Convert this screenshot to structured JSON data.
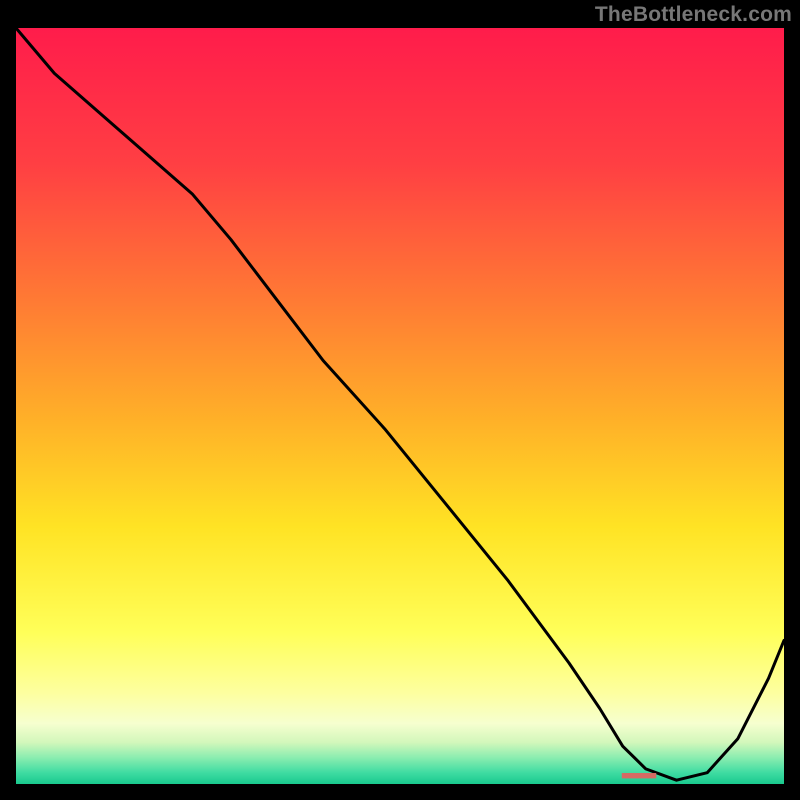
{
  "watermark": "TheBottleneck.com",
  "marker_label": "■■■■■■■■■",
  "chart_data": {
    "type": "line",
    "title": "",
    "xlabel": "",
    "ylabel": "",
    "xlim": [
      0,
      100
    ],
    "ylim": [
      0,
      100
    ],
    "series": [
      {
        "name": "curve",
        "x": [
          0,
          5,
          23,
          28,
          34,
          40,
          48,
          56,
          64,
          72,
          76,
          79,
          82,
          86,
          90,
          94,
          98,
          100
        ],
        "y": [
          100,
          94,
          78,
          72,
          64,
          56,
          47,
          37,
          27,
          16,
          10,
          5,
          2,
          0.5,
          1.5,
          6,
          14,
          19
        ]
      }
    ],
    "marker": {
      "x": 84,
      "y": 0.5
    },
    "gradient_stops": [
      {
        "offset": 0.0,
        "color": "#ff1c4b"
      },
      {
        "offset": 0.18,
        "color": "#ff3f43"
      },
      {
        "offset": 0.36,
        "color": "#ff7a34"
      },
      {
        "offset": 0.52,
        "color": "#ffb128"
      },
      {
        "offset": 0.66,
        "color": "#ffe324"
      },
      {
        "offset": 0.8,
        "color": "#ffff59"
      },
      {
        "offset": 0.88,
        "color": "#fdffa0"
      },
      {
        "offset": 0.92,
        "color": "#f6ffcf"
      },
      {
        "offset": 0.945,
        "color": "#d2f7bb"
      },
      {
        "offset": 0.965,
        "color": "#8bedb0"
      },
      {
        "offset": 0.985,
        "color": "#3fdca2"
      },
      {
        "offset": 1.0,
        "color": "#19c98e"
      }
    ],
    "line_color": "#000000"
  }
}
